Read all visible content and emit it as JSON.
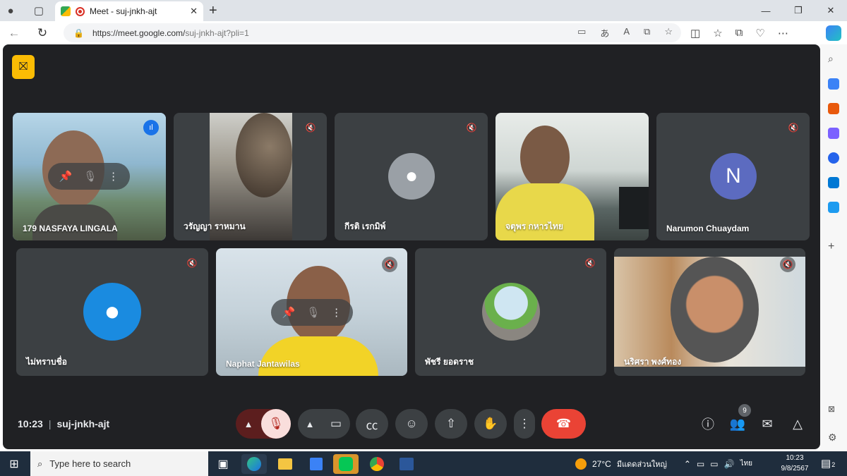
{
  "browser": {
    "tab_title": "Meet - suj-jnkh-ajt",
    "tab_close": "✕",
    "new_tab": "+",
    "url_host": "https://meet.google.com/",
    "url_path": "suj-jnkh-ajt?pli=1"
  },
  "meeting": {
    "time": "10:23",
    "code": "suj-jnkh-ajt",
    "separator": "|",
    "participant_count": "9"
  },
  "participants": [
    {
      "name": "179 NASFAYA LINGALA"
    },
    {
      "name": "วรัญญา ราหมาน"
    },
    {
      "name": "กีรติ เรกมิพ์"
    },
    {
      "name": "จตุพร กหารไทย"
    },
    {
      "name": "Narumon Chuaydam",
      "initial": "N"
    },
    {
      "name": "ไม่ทราบชื่อ"
    },
    {
      "name": "Naphat Jantawilas"
    },
    {
      "name": "พัชรี ยอดราช"
    },
    {
      "name": "นริศรา พงศ์ทอง"
    }
  ],
  "taskbar": {
    "search_placeholder": "Type here to search",
    "weather": "27°C",
    "weather_desc": "มีแดดส่วนใหญ่",
    "lang": "ไทย",
    "clock_time": "10:23",
    "clock_date": "9/8/2567",
    "notif_count": "2"
  },
  "colors": {
    "meet_bg": "#202124",
    "tile_bg": "#3c4043",
    "end_call": "#ea4335",
    "speaking": "#8ab4f8"
  }
}
